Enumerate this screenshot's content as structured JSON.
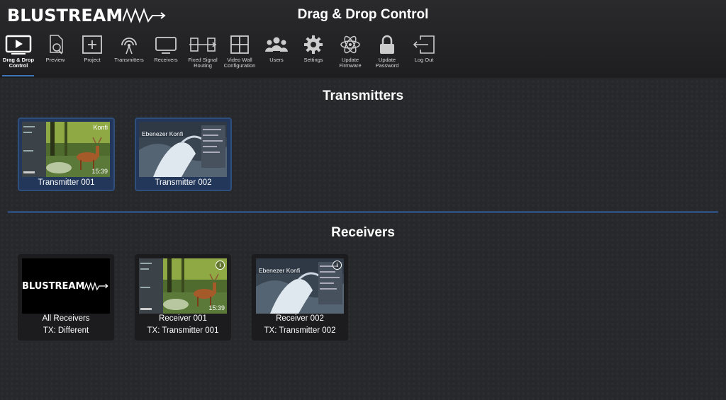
{
  "header": {
    "logo": "BLUSTREAM",
    "title": "Drag & Drop Control"
  },
  "nav": [
    {
      "label_1": "Drag & Drop",
      "label_2": "Control",
      "icon": "play-screen-icon",
      "active": true
    },
    {
      "label_1": "Preview",
      "label_2": "",
      "icon": "preview-doc-icon"
    },
    {
      "label_1": "Project",
      "label_2": "",
      "icon": "project-plus-icon"
    },
    {
      "label_1": "Transmitters",
      "label_2": "",
      "icon": "antenna-icon"
    },
    {
      "label_1": "Receivers",
      "label_2": "",
      "icon": "tv-icon"
    },
    {
      "label_1": "Fixed Signal",
      "label_2": "Routing",
      "icon": "routing-icon"
    },
    {
      "label_1": "Video Wall",
      "label_2": "Configuration",
      "icon": "grid-icon"
    },
    {
      "label_1": "Users",
      "label_2": "",
      "icon": "users-icon"
    },
    {
      "label_1": "Settings",
      "label_2": "",
      "icon": "gear-icon"
    },
    {
      "label_1": "Update",
      "label_2": "Firmware",
      "icon": "atom-icon"
    },
    {
      "label_1": "Update",
      "label_2": "Password",
      "icon": "lock-icon"
    },
    {
      "label_1": "Log Out",
      "label_2": "",
      "icon": "logout-icon"
    }
  ],
  "transmitters": {
    "title": "Transmitters",
    "items": [
      {
        "name": "Transmitter 001",
        "thumb_text": "Konfi",
        "thumb_time": "15:39"
      },
      {
        "name": "Transmitter 002",
        "thumb_text": "Ebenezer Konfi"
      }
    ]
  },
  "receivers": {
    "title": "Receivers",
    "items": [
      {
        "name": "All Receivers",
        "tx": "TX: Different",
        "logo": "BLUSTREAM"
      },
      {
        "name": "Receiver 001",
        "tx": "TX: Transmitter 001",
        "thumb_time": "15:39"
      },
      {
        "name": "Receiver 002",
        "tx": "TX: Transmitter 002",
        "thumb_text": "Ebenezer Konfi"
      }
    ]
  },
  "colors": {
    "accent": "#3c74b4",
    "divider": "#2d4b76",
    "tx_tile_bg": "#22375a"
  }
}
